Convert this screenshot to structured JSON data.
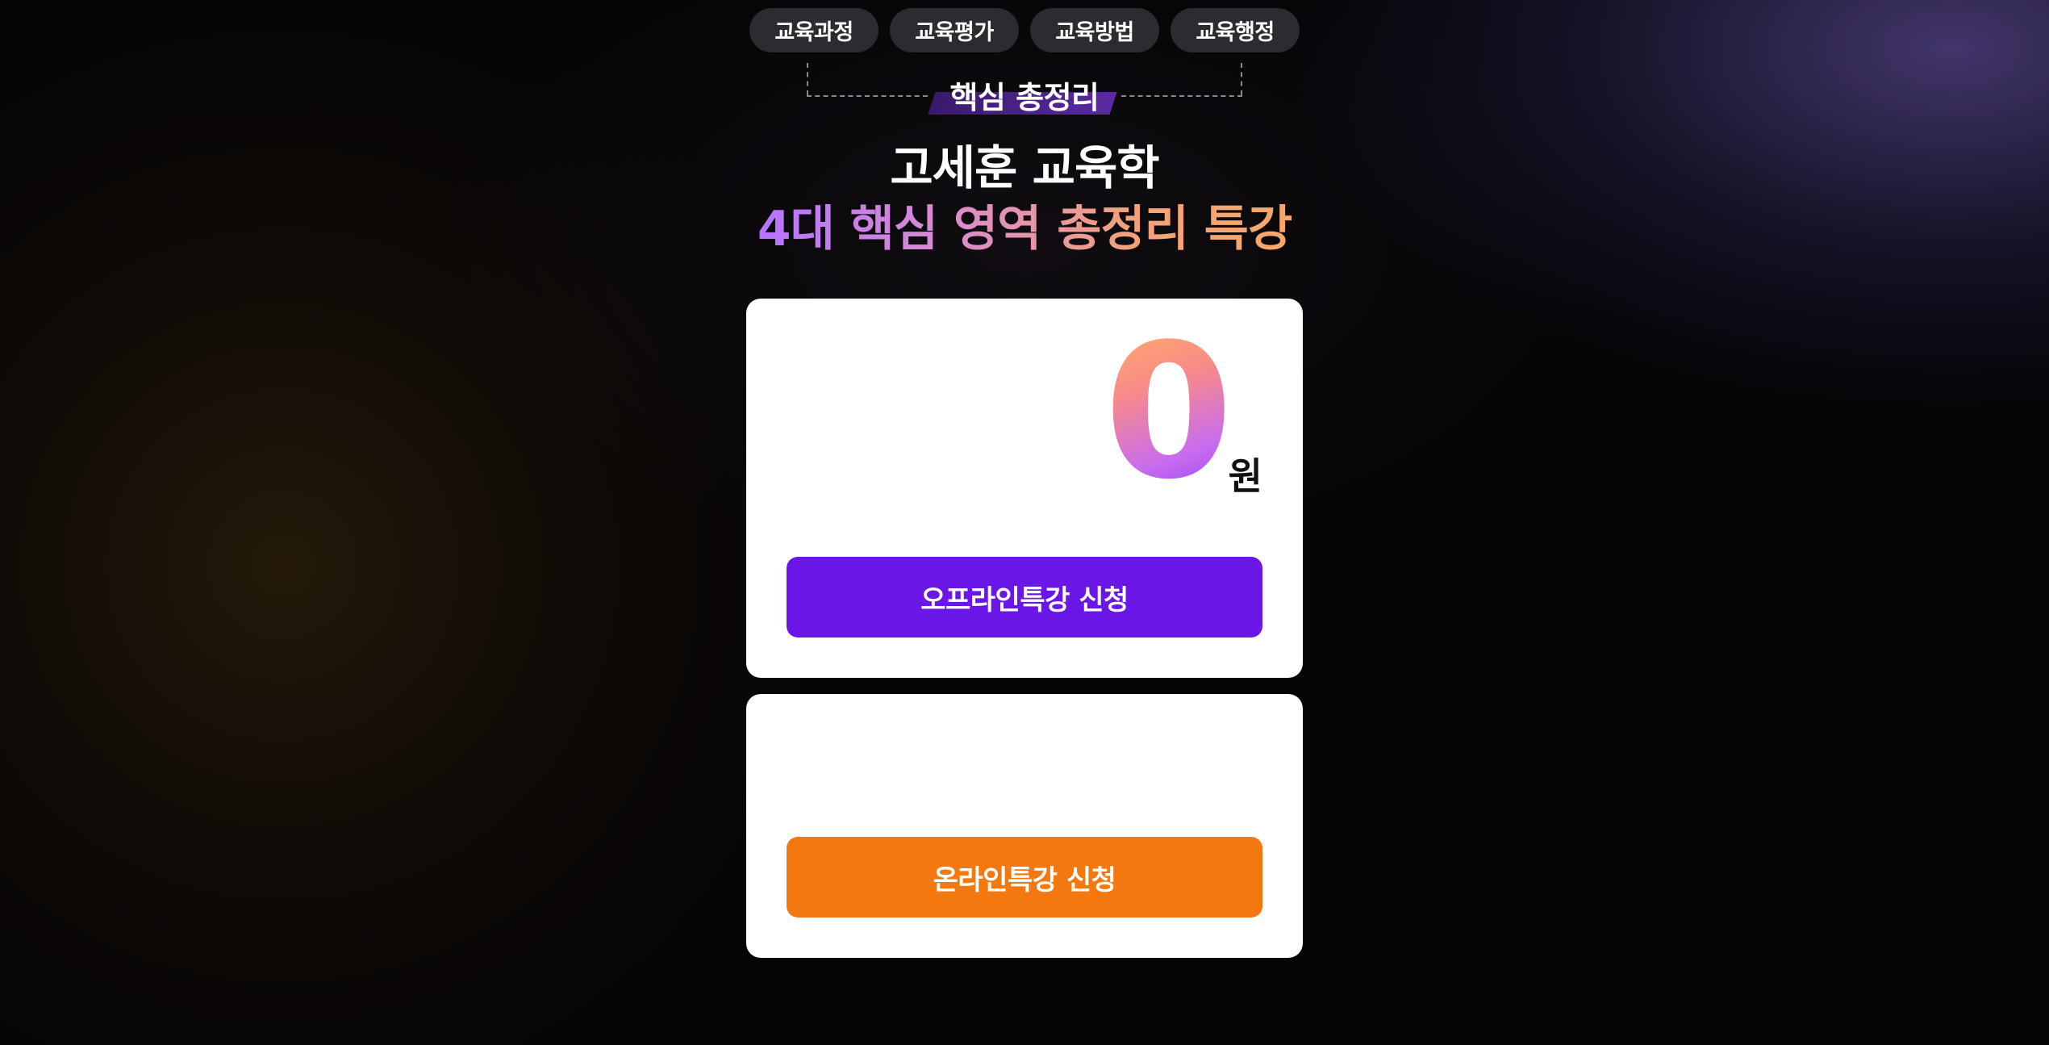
{
  "tabs": [
    {
      "label": "교육과정"
    },
    {
      "label": "교육평가"
    },
    {
      "label": "교육방법"
    },
    {
      "label": "교육행정"
    }
  ],
  "tag": {
    "label": "핵심 총정리"
  },
  "headline": {
    "line1": "고세훈 교육학",
    "line2": "4대 핵심 영역 총정리 특강"
  },
  "offline_card": {
    "price_value": "0",
    "price_unit": "원",
    "button_label": "오프라인특강 신청"
  },
  "online_card": {
    "button_label": "온라인특강 신청"
  },
  "colors": {
    "offline_button": "#6a16e6",
    "online_button": "#f47810",
    "tab_bg": "#2c2b2f"
  }
}
